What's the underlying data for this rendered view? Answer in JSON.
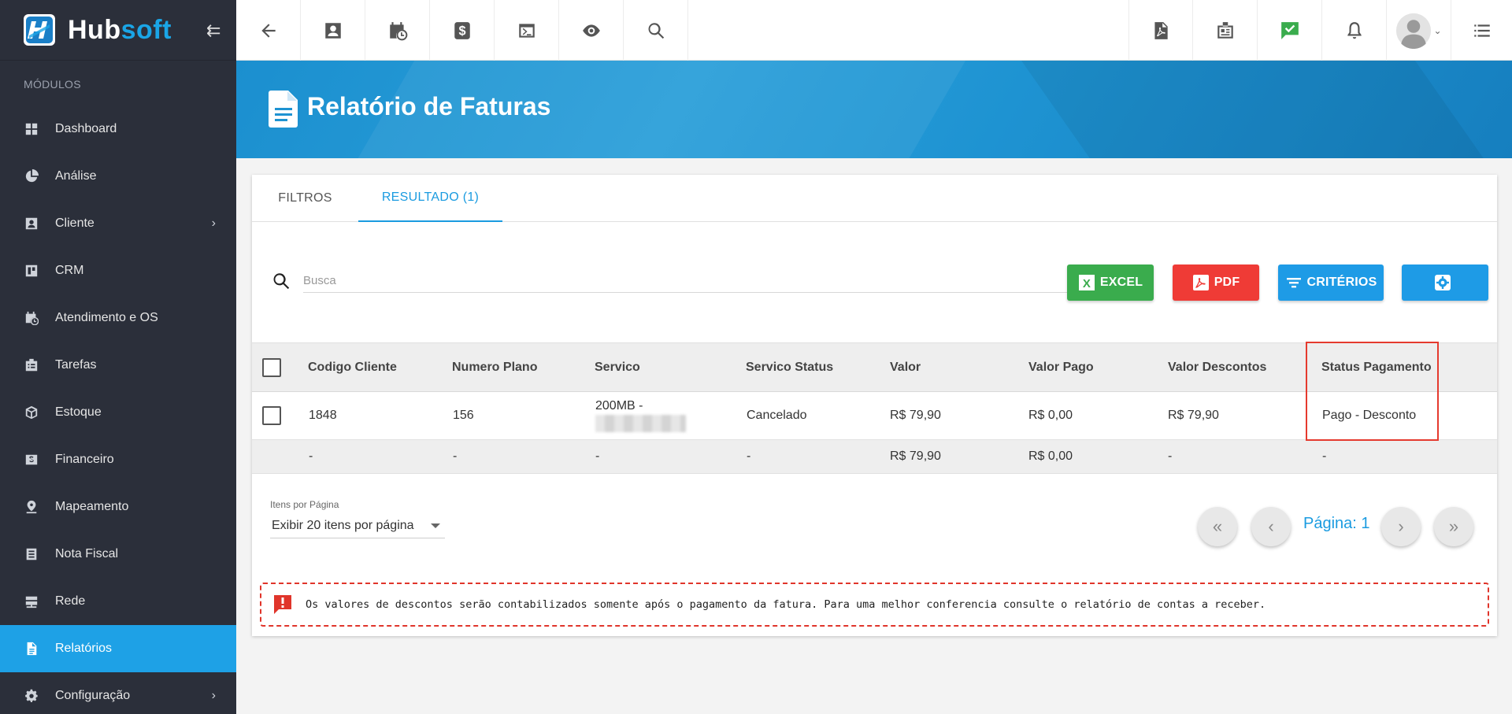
{
  "brand": {
    "name_part1": "Hub",
    "name_part2": "soft"
  },
  "sidebar": {
    "section_label": "MÓDULOS",
    "items": [
      {
        "label": "Dashboard",
        "icon": "dashboard-icon"
      },
      {
        "label": "Análise",
        "icon": "pie-chart-icon"
      },
      {
        "label": "Cliente",
        "icon": "contact-card-icon",
        "has_children": true
      },
      {
        "label": "CRM",
        "icon": "crm-board-icon"
      },
      {
        "label": "Atendimento e OS",
        "icon": "calendar-clock-icon"
      },
      {
        "label": "Tarefas",
        "icon": "tasks-icon"
      },
      {
        "label": "Estoque",
        "icon": "box-icon"
      },
      {
        "label": "Financeiro",
        "icon": "money-icon"
      },
      {
        "label": "Mapeamento",
        "icon": "map-pin-icon"
      },
      {
        "label": "Nota Fiscal",
        "icon": "invoice-icon"
      },
      {
        "label": "Rede",
        "icon": "server-icon"
      },
      {
        "label": "Relatórios",
        "icon": "report-icon",
        "active": true
      },
      {
        "label": "Configuração",
        "icon": "gear-icon",
        "has_children": true
      }
    ]
  },
  "page": {
    "title": "Relatório de Faturas"
  },
  "tabs": [
    {
      "label": "FILTROS"
    },
    {
      "label": "RESULTADO (1)",
      "active": true
    }
  ],
  "search": {
    "placeholder": "Busca",
    "value": ""
  },
  "actions": {
    "excel": "EXCEL",
    "pdf": "PDF",
    "criterios": "CRITÉRIOS"
  },
  "table": {
    "columns": [
      "Codigo Cliente",
      "Numero Plano",
      "Servico",
      "Servico Status",
      "Valor",
      "Valor Pago",
      "Valor Descontos",
      "Status Pagamento"
    ],
    "rows": [
      {
        "codigo_cliente": "1848",
        "numero_plano": "156",
        "servico": "200MB -",
        "servico_status": "Cancelado",
        "valor": "R$ 79,90",
        "valor_pago": "R$ 0,00",
        "valor_descontos": "R$ 79,90",
        "status_pagamento": "Pago - Desconto"
      }
    ],
    "totals": {
      "codigo_cliente": "-",
      "numero_plano": "-",
      "servico": "-",
      "servico_status": "-",
      "valor": "R$ 79,90",
      "valor_pago": "R$ 0,00",
      "valor_descontos": "-",
      "status_pagamento": "-"
    }
  },
  "pagination": {
    "items_per_page_label": "Itens por Página",
    "items_per_page_value": "Exibir 20 itens por página",
    "page_label": "Página: 1"
  },
  "alert": {
    "text": "Os valores de descontos serão contabilizados somente após o pagamento da fatura. Para uma melhor conferencia consulte o relatório de contas a receber."
  },
  "colors": {
    "accent": "#1ea1e6",
    "excel": "#3aac4d",
    "pdf": "#ef3b36",
    "sidebar": "#2b2f3a",
    "highlight": "#e53a2e"
  }
}
